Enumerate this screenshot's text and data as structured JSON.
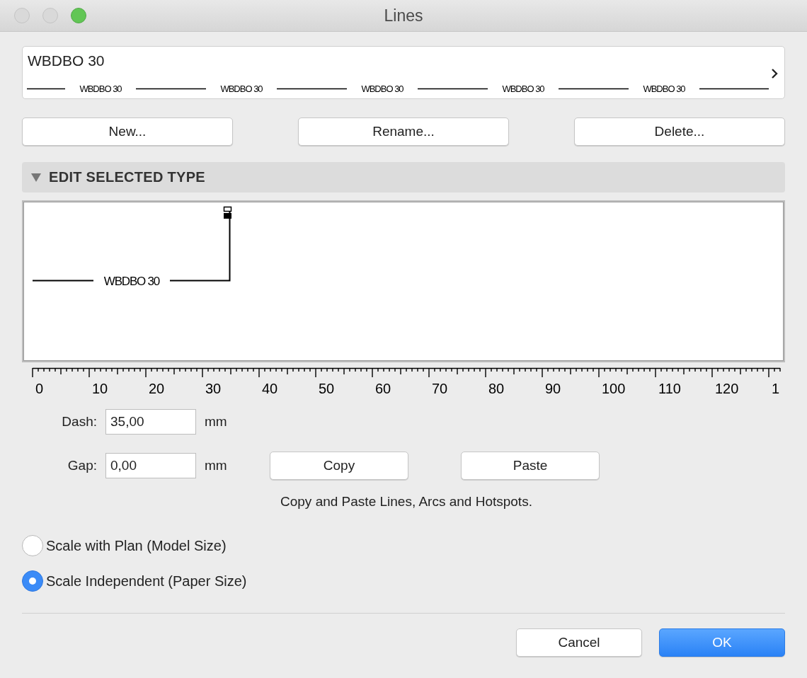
{
  "window": {
    "title": "Lines"
  },
  "line_type": {
    "name": "WBDBO 30",
    "pattern_labels": [
      "WBDBO 30",
      "WBDBO 30",
      "WBDBO 30",
      "WBDBO 30",
      "WBDBO 30"
    ]
  },
  "type_buttons": [
    "New...",
    "Rename...",
    "Delete..."
  ],
  "section": {
    "title": "EDIT SELECTED TYPE",
    "expanded": true
  },
  "canvas": {
    "label": "WBDBO 30"
  },
  "ruler": {
    "labels": [
      "0",
      "10",
      "20",
      "30",
      "40",
      "50",
      "60",
      "70",
      "80",
      "90",
      "100",
      "110",
      "120",
      "1"
    ]
  },
  "dash": {
    "label": "Dash:",
    "value": "35,00",
    "unit": "mm"
  },
  "gap": {
    "label": "Gap:",
    "value": "0,00",
    "unit": "mm"
  },
  "clipboard_buttons": [
    "Copy",
    "Paste"
  ],
  "clipboard_note": "Copy and Paste Lines, Arcs and Hotspots.",
  "scale_options": [
    {
      "label": "Scale with Plan (Model Size)",
      "selected": false
    },
    {
      "label": "Scale Independent (Paper Size)",
      "selected": true
    }
  ],
  "footer_buttons": [
    {
      "label": "Cancel",
      "default": false
    },
    {
      "label": "OK",
      "default": true
    }
  ]
}
